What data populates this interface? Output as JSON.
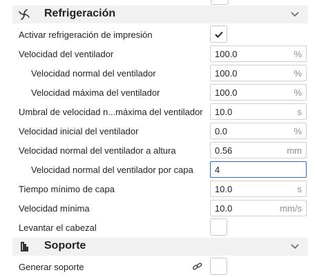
{
  "cooling": {
    "title": "Refrigeración",
    "icon": "fan-icon",
    "rows": [
      {
        "label": "Activar refrigeración de impresión",
        "type": "checkbox",
        "checked": true
      },
      {
        "label": "Velocidad del ventilador",
        "value": "100.0",
        "unit": "%"
      },
      {
        "label": "Velocidad normal del ventilador",
        "value": "100.0",
        "unit": "%"
      },
      {
        "label": "Velocidad máxima del ventilador",
        "value": "100.0",
        "unit": "%"
      },
      {
        "label": "Umbral de velocidad n...máxima del ventilador",
        "value": "10.0",
        "unit": "s"
      },
      {
        "label": "Velocidad inicial del ventilador",
        "value": "0.0",
        "unit": "%"
      },
      {
        "label": "Velocidad normal del ventilador a altura",
        "value": "0.56",
        "unit": "mm"
      },
      {
        "label": "Velocidad normal del ventilador por capa",
        "value": "4",
        "unit": ""
      },
      {
        "label": "Tiempo mínimo de capa",
        "value": "10.0",
        "unit": "s"
      },
      {
        "label": "Velocidad mínima",
        "value": "10.0",
        "unit": "mm/s"
      },
      {
        "label": "Levantar el cabezal",
        "type": "checkbox",
        "checked": false
      }
    ]
  },
  "support": {
    "title": "Soporte",
    "icon": "support-icon",
    "rows": [
      {
        "label": "Generar soporte",
        "type": "checkbox",
        "checked": false,
        "linked_icon": "link-icon"
      }
    ]
  },
  "colors": {
    "focus": "#2d6fd6",
    "section_bg": "#f1f1f1"
  }
}
